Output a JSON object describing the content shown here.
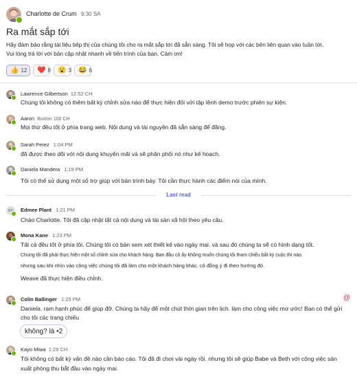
{
  "post": {
    "author": "Charlotte de Crum",
    "time": "9:30 SA",
    "title": "Ra mắt sắp tới",
    "body_line1": "Hãy đảm bảo rằng tài liệu tiếp thị của chúng tôi cho ra mắt sắp tới đã sẵn sàng. Tôi sẽ họp với các bên liên quan vào tuần tới.",
    "body_line2": "Vui lòng trả lời với bản cập nhật nhanh về tiến trình của bạn. Cảm ơn!",
    "reactions": [
      {
        "emoji": "👍",
        "icon": "thumbs-up-icon",
        "count": "12"
      },
      {
        "emoji": "❤️",
        "icon": "heart-icon",
        "count": "8"
      },
      {
        "emoji": "😮",
        "icon": "surprised-icon",
        "count": "3"
      },
      {
        "emoji": "😂",
        "icon": "laughing-icon",
        "count": "6"
      }
    ]
  },
  "divider_label": "Last read",
  "replies": [
    {
      "author": "Lawrence Gilbertson",
      "time": "12:52 CH",
      "lines": [
        "Chúng tôi không có thêm bất kỳ chỉnh sửa nào để thực hiện đối với tập lệnh demo trước phiên sự kiện."
      ]
    },
    {
      "author": "Aaron",
      "time": "Buxton 100 CH",
      "lines": [
        "Mọi thứ đều tốt ở phía trang web. Nội dung và tài nguyên đã sẵn sàng để đăng."
      ]
    },
    {
      "author": "Sarah Perez",
      "time": "1:04 PM",
      "lines": [
        "đã được theo dõi với nội dung khuyến mãi và sẽ phân phối nó như kế hoạch."
      ]
    },
    {
      "author": "Daniela Mandera",
      "time": "1:19 PM",
      "lines": [
        "Tôi có thể sử dụng một số trợ giúp với bản trình bày. Tôi cần thực hành các điểm nói của mình."
      ]
    },
    {
      "author": "Edmee Plant",
      "time": "1:21 PM",
      "initials": "EP",
      "lines": [
        "Chào Charlotte. Tôi đã cập nhật tất cả nội dung và tài sản xã hội theo yêu cầu."
      ]
    },
    {
      "author": "Mona Kane",
      "time": "1:23 PM",
      "lines": [
        "Tất cả đều tốt ở phía tôi. Chúng tôi có bản xem xét thiết kế vào ngày mai. và sau đó chúng ta sẽ có hình dạng tốt.",
        "Chúng tôi đã phải thực hiện một số chỉnh sửa cho khách hàng. Ban đầu cô ấy không muốn chúng tôi tham chiếu bất kỳ cuộc thi nào.",
        "nhưng sau khi nhìn vào công việc chúng tôi đã làm cho một khách hàng khác. cô đồng ý đi theo hướng đó.",
        "Weave đã thực hiện điều chỉnh."
      ]
    },
    {
      "author": "Colin Ballinger",
      "time": "1:25 PM",
      "lines": [
        "Daniela. rạm hạnh phúc để giúp đỡ. Chúng ta hãy để một chút thời gian trên lịch. làm cho công việc mơ ước! Bạn có thể gửi",
        "cho tôi các trang chiếu"
      ],
      "extra": "không? là •2",
      "mention_icon": "@"
    },
    {
      "author": "Kayo Miwa",
      "time": "1:29 CH",
      "lines": [
        "Tôi không có bất kỳ vấn đề nào cần báo cáo. Tôi đã đi chơi vài ngày rồi. nhưng tôi sẽ giúp Babe và Beth với công việc sản",
        "xuất phòng thu bắt đầu vào ngày mai."
      ]
    }
  ],
  "colors": {
    "accent": "#5b5fc7",
    "presence": "#6bb700",
    "mention": "#c4314b"
  }
}
